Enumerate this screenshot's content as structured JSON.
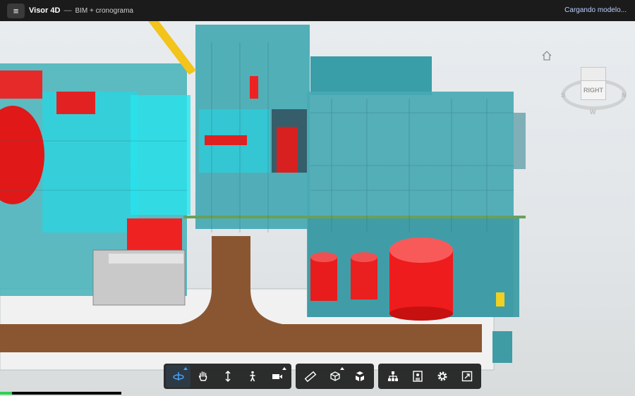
{
  "header": {
    "menu_icon": "hamburger-icon",
    "app_title": "Visor 4D",
    "separator": "—",
    "subtitle": "BIM + cronograma",
    "status": "Cargando modelo..."
  },
  "viewcube": {
    "face_label": "RIGHT",
    "compass": {
      "west": "S",
      "east": "N",
      "north": "E",
      "south": "W"
    },
    "home_icon": "home-icon"
  },
  "toolbar": {
    "groups": [
      {
        "name": "navigation",
        "tools": [
          {
            "icon": "orbit-icon",
            "active": true,
            "has_menu": true
          },
          {
            "icon": "pan-hand-icon"
          },
          {
            "icon": "zoom-icon"
          },
          {
            "icon": "first-person-icon"
          },
          {
            "icon": "camera-icon",
            "has_menu": true
          }
        ]
      },
      {
        "name": "analysis",
        "tools": [
          {
            "icon": "measure-icon"
          },
          {
            "icon": "section-box-icon",
            "has_menu": true
          },
          {
            "icon": "explode-icon"
          }
        ]
      },
      {
        "name": "settings",
        "tools": [
          {
            "icon": "model-browser-icon"
          },
          {
            "icon": "properties-icon"
          },
          {
            "icon": "settings-gear-icon"
          },
          {
            "icon": "fullscreen-icon"
          }
        ]
      }
    ]
  },
  "loading": {
    "progress": 0.1
  },
  "colors": {
    "topbar": "#1b1b1b",
    "structure_cyan": "#4fb8c0",
    "equipment_red": "#e02020",
    "ground_brown": "#8a5632",
    "progress_green": "#2bd153"
  }
}
